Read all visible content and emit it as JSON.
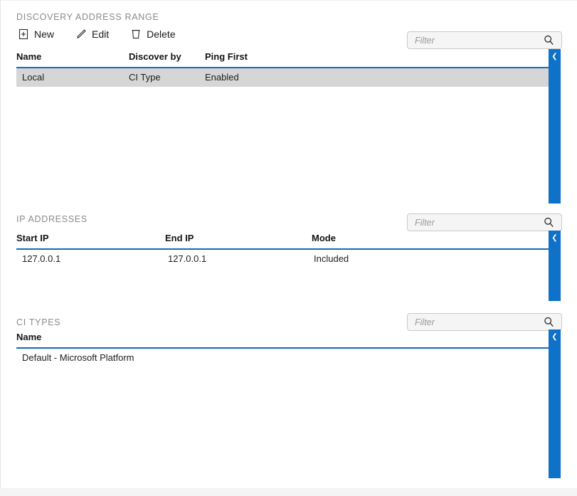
{
  "panels": [
    {
      "label": "DISCOVERY ADDRESS RANGE",
      "toolbar": {
        "new_label": "New",
        "edit_label": "Edit",
        "delete_label": "Delete"
      },
      "filter": {
        "value": "",
        "placeholder": "Filter"
      },
      "columns": [
        "Name",
        "Discover by",
        "Ping First"
      ],
      "rows": [
        {
          "name": "Local",
          "discover_by": "CI Type",
          "ping_first": "Enabled",
          "selected": true
        }
      ]
    },
    {
      "label": "IP ADDRESSES",
      "filter": {
        "value": "",
        "placeholder": "Filter"
      },
      "columns": [
        "Start IP",
        "End IP",
        "Mode"
      ],
      "rows": [
        {
          "start_ip": "127.0.0.1",
          "end_ip": "127.0.0.1",
          "mode": "Included",
          "selected": false
        }
      ]
    },
    {
      "label": "CI TYPES",
      "filter": {
        "value": "",
        "placeholder": "Filter"
      },
      "columns": [
        "Name"
      ],
      "rows": [
        {
          "name": "Default - Microsoft Platform",
          "selected": false
        }
      ]
    }
  ],
  "icons": {
    "new": "new-document-icon",
    "edit": "pencil-icon",
    "delete": "trash-icon",
    "search": "magnifier-icon",
    "collapse": "chevron-left-icon"
  },
  "colors": {
    "accent": "#0f6cbd",
    "handle": "#0f71c8",
    "selected_row": "#d6d6d6",
    "section_label": "#8a8a8a"
  }
}
